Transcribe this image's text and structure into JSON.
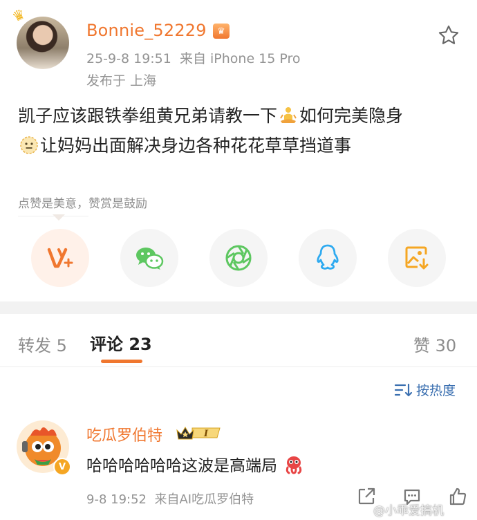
{
  "post": {
    "author": "Bonnie_52229",
    "datetime": "25-9-8 19:51",
    "source": "来自 iPhone 15 Pro",
    "location": "发布于 上海",
    "text_line1": "凯子应该跟铁拳组黄兄弟请教一下",
    "text_line1b": "如何完美隐身",
    "text_line2": "让妈妈出面解决身边各种花花草草挡道事"
  },
  "reward_tip": "点赞是美意，赞赏是鼓励",
  "share": {
    "items": [
      "v-plus-icon",
      "wechat-icon",
      "moments-icon",
      "qq-icon",
      "save-image-icon"
    ]
  },
  "tabs": {
    "repost_label": "转发 5",
    "comment_label": "评论 23",
    "like_label": "赞 30"
  },
  "sort_label": "按热度",
  "comment": {
    "author": "吃瓜罗伯特",
    "level_badge": "I",
    "verified_mark": "V",
    "text": "哈哈哈哈哈哈这波是高端局",
    "datetime": "9-8 19:52",
    "source": "来自AI吃瓜罗伯特"
  },
  "watermark": "@小乖爱搞机",
  "colors": {
    "accent": "#f0772f",
    "link_blue": "#3a6fb0",
    "meta_gray": "#939393"
  }
}
